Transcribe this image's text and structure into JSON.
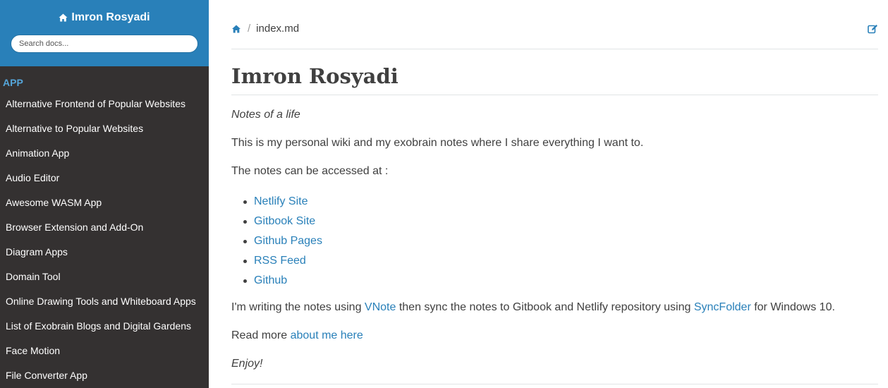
{
  "sidebar": {
    "title": "Imron Rosyadi",
    "search_placeholder": "Search docs...",
    "caption": "APP",
    "items": [
      {
        "label": "Alternative Frontend of Popular Websites"
      },
      {
        "label": "Alternative to Popular Websites"
      },
      {
        "label": "Animation App"
      },
      {
        "label": "Audio Editor"
      },
      {
        "label": "Awesome WASM App"
      },
      {
        "label": "Browser Extension and Add-On"
      },
      {
        "label": "Diagram Apps"
      },
      {
        "label": "Domain Tool"
      },
      {
        "label": "Online Drawing Tools and Whiteboard Apps"
      },
      {
        "label": "List of Exobrain Blogs and Digital Gardens"
      },
      {
        "label": "Face Motion"
      },
      {
        "label": "File Converter App"
      }
    ]
  },
  "breadcrumb": {
    "separator": "/",
    "current": "index.md"
  },
  "page": {
    "title": "Imron Rosyadi",
    "tagline": "Notes of a life",
    "intro": "This is my personal wiki and my exobrain notes where I share everything I want to.",
    "access_text": "The notes can be accessed at :",
    "links": [
      {
        "label": "Netlify Site"
      },
      {
        "label": "Gitbook Site"
      },
      {
        "label": "Github Pages"
      },
      {
        "label": "RSS Feed"
      },
      {
        "label": "Github"
      }
    ],
    "writing": {
      "prefix": "I'm writing the notes using ",
      "vnote": "VNote",
      "middle": " then sync the notes to Gitbook and Netlify repository using ",
      "syncfolder": "SyncFolder",
      "suffix": " for Windows 10."
    },
    "read_more": {
      "prefix": "Read more ",
      "link": "about me here"
    },
    "enjoy": "Enjoy!"
  },
  "colors": {
    "accent": "#2980b9",
    "sidebar_bg": "#343131",
    "caption": "#55a5d9",
    "text": "#404040"
  },
  "icons": {
    "site_home": "home-icon",
    "breadcrumb_home": "home-icon",
    "edit": "edit-icon"
  }
}
